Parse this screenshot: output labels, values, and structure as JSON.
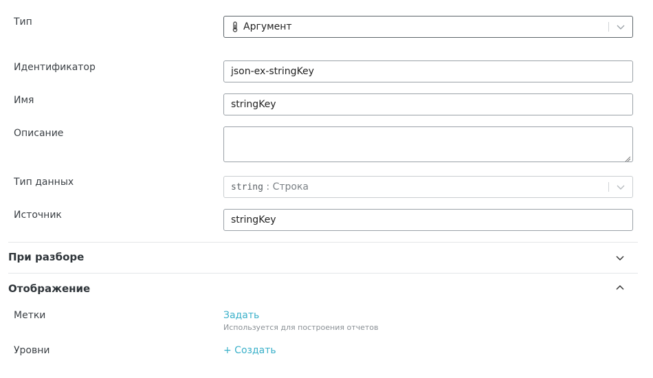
{
  "fields": {
    "type": {
      "label": "Тип",
      "value": "Аргумент",
      "icon": "thermometer-icon"
    },
    "identifier": {
      "label": "Идентификатор",
      "value": "json-ex-stringKey"
    },
    "name": {
      "label": "Имя",
      "value": "stringKey"
    },
    "description": {
      "label": "Описание",
      "value": ""
    },
    "data_type": {
      "label": "Тип данных",
      "code": "string",
      "separator": " : ",
      "text": "Строка"
    },
    "source": {
      "label": "Источник",
      "value": "stringKey"
    }
  },
  "sections": {
    "parsing": {
      "title": "При разборе",
      "state": "collapsed"
    },
    "display": {
      "title": "Отображение",
      "state": "expanded"
    }
  },
  "display": {
    "tags": {
      "label": "Метки",
      "link": "Задать",
      "hint": "Используется для построения отчетов"
    },
    "levels": {
      "label": "Уровни",
      "link": "+ Создать"
    }
  },
  "colors": {
    "accent": "#3ab0c9",
    "text": "#3a3f44",
    "border": "#9aa1a7"
  }
}
